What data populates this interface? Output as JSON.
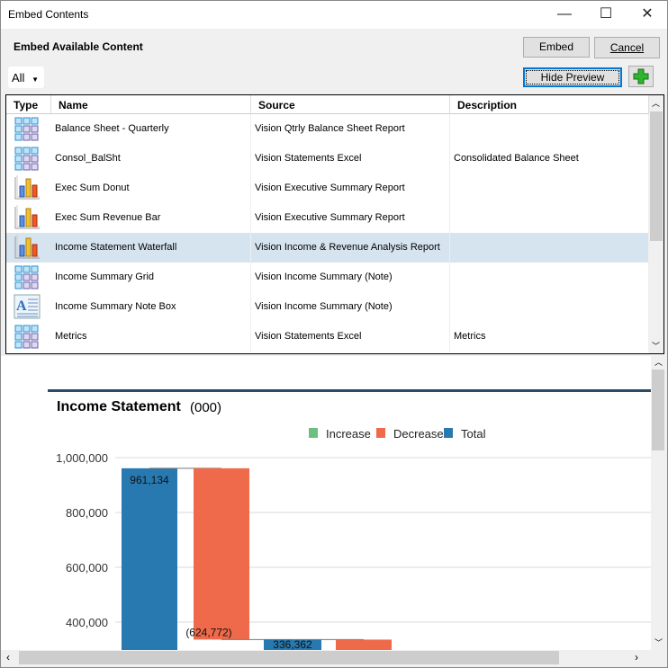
{
  "window": {
    "title": "Embed Contents",
    "minimize": "—",
    "maximize": "☐",
    "close": "✕"
  },
  "header": {
    "title": "Embed Available Content",
    "embed_label": "Embed",
    "cancel_label": "Cancel",
    "hide_preview_label": "Hide Preview",
    "add_icon": "plus-icon",
    "filter_value": "All"
  },
  "table": {
    "columns": [
      "Type",
      "Name",
      "Source",
      "Description"
    ],
    "rows": [
      {
        "type": "grid",
        "name": "Balance Sheet - Quarterly",
        "source": "Vision Qtrly Balance Sheet Report",
        "description": ""
      },
      {
        "type": "grid",
        "name": "Consol_BalSht",
        "source": "Vision Statements Excel",
        "description": "Consolidated Balance Sheet"
      },
      {
        "type": "chart",
        "name": "Exec Sum Donut",
        "source": "Vision Executive Summary Report",
        "description": ""
      },
      {
        "type": "chart",
        "name": "Exec Sum Revenue Bar",
        "source": "Vision Executive Summary Report",
        "description": ""
      },
      {
        "type": "chart",
        "name": "Income Statement Waterfall",
        "source": "Vision Income & Revenue Analysis Report",
        "description": "",
        "selected": true
      },
      {
        "type": "grid",
        "name": "Income Summary Grid",
        "source": "Vision Income Summary (Note)",
        "description": ""
      },
      {
        "type": "note",
        "name": "Income Summary Note Box",
        "source": "Vision Income Summary (Note)",
        "description": ""
      },
      {
        "type": "grid",
        "name": "Metrics",
        "source": "Vision Statements Excel",
        "description": "Metrics"
      }
    ]
  },
  "preview": {
    "title": "Income Statement",
    "subtitle": "(000)"
  },
  "chart_data": {
    "type": "bar",
    "subtype": "waterfall",
    "title": "Income Statement",
    "subtitle": "(000)",
    "legend": {
      "position": "top",
      "entries": [
        {
          "name": "Increase",
          "color": "#6bbf7f"
        },
        {
          "name": "Decrease",
          "color": "#ee6a4a"
        },
        {
          "name": "Total",
          "color": "#2779b0"
        }
      ]
    },
    "yticks": [
      "1,000,000",
      "800,000",
      "600,000",
      "400,000"
    ],
    "ytick_values": [
      1000000,
      800000,
      600000,
      400000
    ],
    "grid": true,
    "bars": [
      {
        "kind": "Total",
        "value": 961134,
        "label": "961,134"
      },
      {
        "kind": "Decrease",
        "value": -624772,
        "label": "(624,772)"
      },
      {
        "kind": "Total",
        "value": 336362,
        "label": "336,362"
      },
      {
        "kind": "Decrease",
        "value": null,
        "label": ""
      }
    ]
  },
  "colors": {
    "selection": "#d6e4f0",
    "total": "#2779b0",
    "decrease": "#ee6a4a",
    "increase": "#6bbf7f",
    "preview_rule": "#2c4a63"
  }
}
